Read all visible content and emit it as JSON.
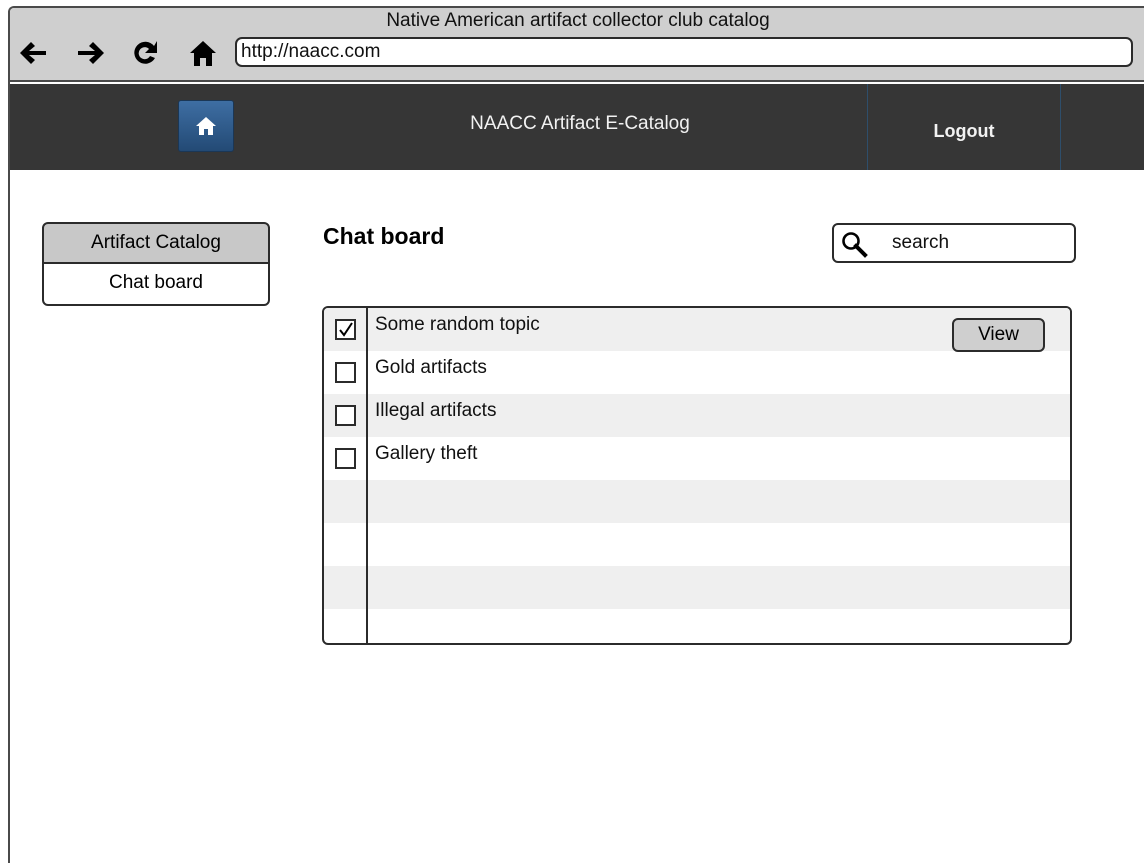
{
  "browser": {
    "window_title": "Native American artifact collector club catalog",
    "url": "http://naacc.com",
    "nav_icons": [
      "back-arrow-icon",
      "forward-arrow-icon",
      "reload-icon",
      "home-icon"
    ]
  },
  "header": {
    "home_icon": "home-icon",
    "title": "NAACC Artifact E-Catalog",
    "logout_label": "Logout"
  },
  "sidebar": {
    "items": [
      {
        "label": "Artifact Catalog",
        "active": true
      },
      {
        "label": "Chat board",
        "active": false
      }
    ]
  },
  "main": {
    "title": "Chat board",
    "search": {
      "placeholder": "search",
      "icon": "search-icon"
    },
    "topics": [
      {
        "label": "Some random topic",
        "checked": true,
        "view_label": "View"
      },
      {
        "label": "Gold artifacts",
        "checked": false
      },
      {
        "label": "Illegal artifacts",
        "checked": false
      },
      {
        "label": "Gallery theft",
        "checked": false
      },
      {
        "label": "",
        "checked": null
      },
      {
        "label": "",
        "checked": null
      },
      {
        "label": "",
        "checked": null
      },
      {
        "label": "",
        "checked": null
      }
    ]
  },
  "colors": {
    "header_bg": "#363636",
    "chrome_bg": "#cfcfcf",
    "home_tile": "#2f5f93",
    "row_shade": "#efefef",
    "active_nav": "#c8c8c8"
  }
}
